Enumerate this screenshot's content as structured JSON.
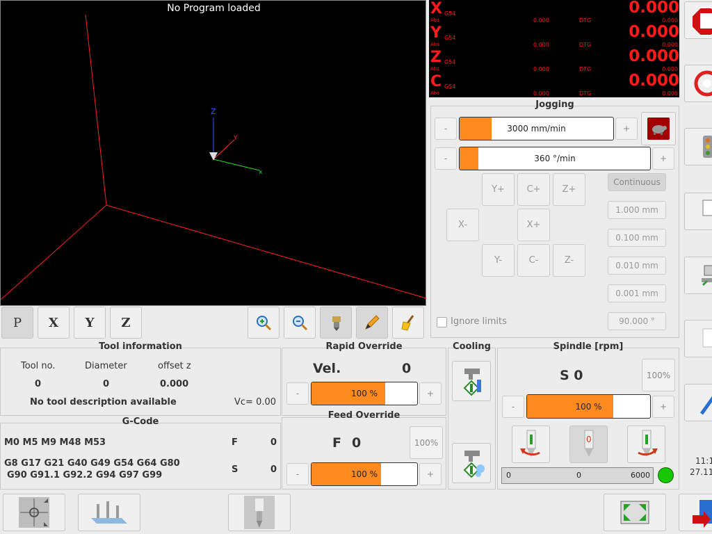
{
  "viewport": {
    "title": "No Program loaded"
  },
  "view_toolbar": {
    "p_label": "P",
    "x_label": "X",
    "y_label": "Y",
    "z_label": "Z"
  },
  "dro": {
    "axes": [
      {
        "axis": "X",
        "coord": "G54",
        "abs_label": "Abs",
        "abs_value": "0.000",
        "dtg_label": "DTG",
        "dtg_value": "0.000",
        "value": "0.000"
      },
      {
        "axis": "Y",
        "coord": "G54",
        "abs_label": "Abs",
        "abs_value": "0.000",
        "dtg_label": "DTG",
        "dtg_value": "0.000",
        "value": "0.000"
      },
      {
        "axis": "Z",
        "coord": "G54",
        "abs_label": "Abs",
        "abs_value": "0.000",
        "dtg_label": "DTG",
        "dtg_value": "0.000",
        "value": "0.000"
      },
      {
        "axis": "C",
        "coord": "G54",
        "abs_label": "Abs",
        "abs_value": "0.000",
        "dtg_label": "DTG",
        "dtg_value": "0.000",
        "value": "0.000"
      }
    ]
  },
  "jogging": {
    "title": "Jogging",
    "linear_speed": "3000 mm/min",
    "linear_fill": 0.21,
    "angular_speed": "360 °/min",
    "angular_fill": 0.1,
    "minus": "-",
    "plus": "+",
    "buttons": {
      "y_plus": "Y+",
      "c_plus": "C+",
      "z_plus": "Z+",
      "x_minus": "X-",
      "x_plus": "X+",
      "y_minus": "Y-",
      "c_minus": "C-",
      "z_minus": "Z-"
    },
    "increments": [
      "Continuous",
      "1.000 mm",
      "0.100 mm",
      "0.010 mm",
      "0.001 mm"
    ],
    "angle": "90.000 °",
    "ignore_limits": "Ignore limits"
  },
  "tool_info": {
    "title": "Tool information",
    "col_tool": "Tool no.",
    "col_diameter": "Diameter",
    "col_offset": "offset z",
    "tool_no": "0",
    "diameter": "0",
    "offset": "0.000",
    "description": "No tool description available",
    "vc": "Vc= 0.00"
  },
  "gcode": {
    "title": "G-Code",
    "mcodes": "M0 M5 M9 M48 M53",
    "gcodes_line1": "G8 G17 G21 G40 G49 G54 G64 G80",
    "gcodes_line2": "G90 G91.1 G92.2 G94 G97 G99",
    "f_label": "F",
    "f_value": "0",
    "s_label": "S",
    "s_value": "0"
  },
  "rapid": {
    "title": "Rapid Override",
    "vel_label": "Vel.",
    "vel_value": "0",
    "percent": "100 %",
    "fill": 0.7,
    "minus": "-",
    "plus": "+"
  },
  "feed": {
    "title": "Feed Override",
    "f_label": "F",
    "f_value": "0",
    "reset": "100%",
    "percent": "100 %",
    "fill": 0.66,
    "minus": "-",
    "plus": "+"
  },
  "cooling": {
    "title": "Cooling"
  },
  "spindle": {
    "title": "Spindle [rpm]",
    "s_display": "S 0",
    "reset": "100%",
    "percent": "100 %",
    "fill": 0.7,
    "minus": "-",
    "plus": "+",
    "bar_min": "0",
    "bar_value": "0",
    "bar_max": "6000",
    "stop_label": "0"
  },
  "clock": {
    "time": "11:1",
    "date": "27.11"
  },
  "colors": {
    "accent": "#ff8a1f",
    "dro_text": "#ff1a1a",
    "status_ok": "#17c700"
  }
}
